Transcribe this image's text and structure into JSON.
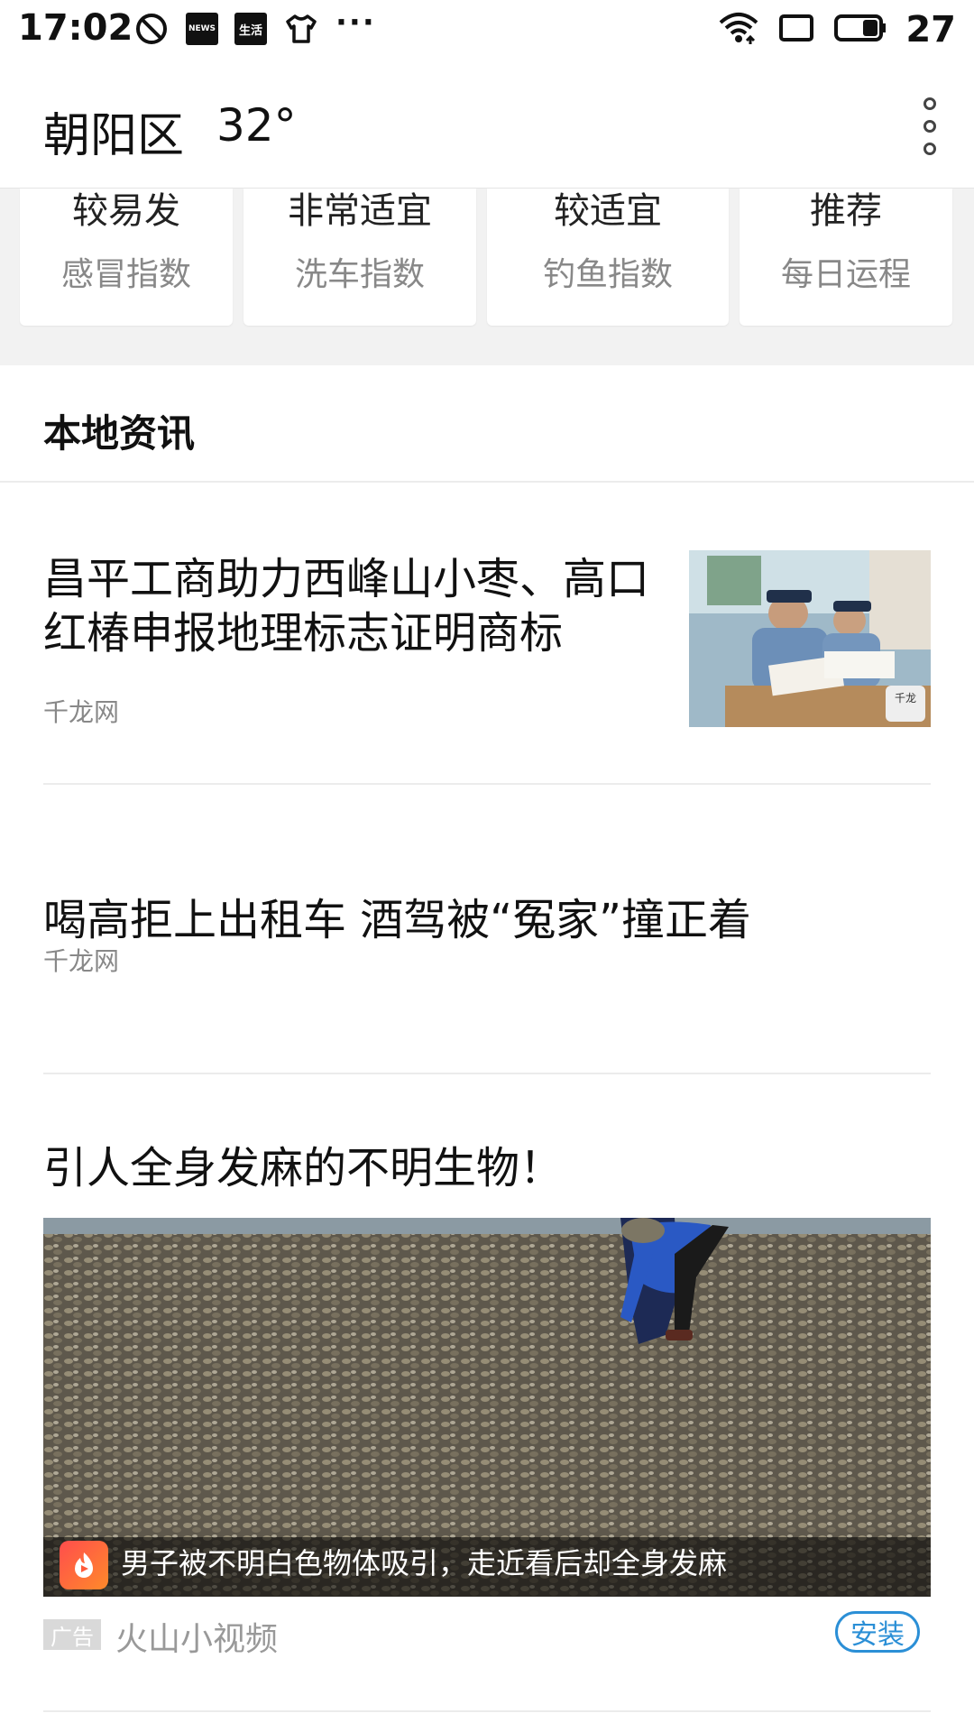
{
  "status_bar": {
    "time": "17:02",
    "icons": [
      "do-not-disturb-icon",
      "news-icon",
      "shenghuo-icon",
      "shirt-icon",
      "more-dots-icon"
    ],
    "news_icon_text": "NEWS",
    "shenghuo_icon_text": "生活",
    "more": "···",
    "battery_level": "27"
  },
  "header": {
    "city": "朝阳区",
    "temperature": "32°"
  },
  "index_cards": [
    {
      "value": "较易发",
      "label": "感冒指数"
    },
    {
      "value": "非常适宜",
      "label": "洗车指数"
    },
    {
      "value": "较适宜",
      "label": "钓鱼指数"
    },
    {
      "value": "推荐",
      "label": "每日运程"
    }
  ],
  "section": {
    "title": "本地资讯"
  },
  "news": [
    {
      "title": "昌平工商助力西峰山小枣、高口红椿申报地理标志证明商标",
      "source": "千龙网",
      "watermark": "千龙"
    },
    {
      "title": "喝高拒上出租车 酒驾被“冤家”撞正着",
      "source": "千龙网"
    }
  ],
  "ad": {
    "title": "引人全身发麻的不明生物！",
    "caption": "男子被不明白色物体吸引，走近看后却全身发麻",
    "tag": "广告",
    "source": "火山小视频",
    "button": "安装"
  },
  "colors": {
    "accent": "#2b8fd6",
    "background_gray": "#f2f2f2"
  }
}
